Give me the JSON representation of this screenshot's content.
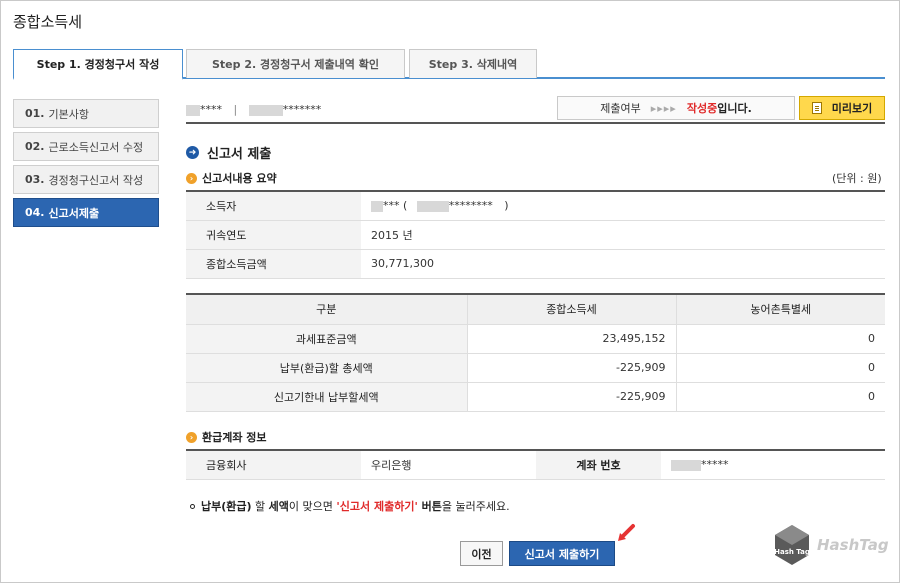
{
  "window": {
    "title": "종합소득세"
  },
  "tabs": [
    {
      "label": "Step 1. 경정청구서 작성",
      "active": true
    },
    {
      "label": "Step 2. 경정청구서 제출내역 확인",
      "active": false
    },
    {
      "label": "Step 3. 삭제내역",
      "active": false
    }
  ],
  "sidebar": [
    {
      "num": "01.",
      "label": "기본사항",
      "active": false
    },
    {
      "num": "02.",
      "label": "근로소득신고서 수정",
      "active": false
    },
    {
      "num": "03.",
      "label": "경정청구신고서 작성",
      "active": false
    },
    {
      "num": "04.",
      "label": "신고서제출",
      "active": true
    }
  ],
  "topbar": {
    "user_name_masked": "****",
    "separator": "|",
    "user_id_masked": "*******",
    "status_label": "제출여부",
    "status_arrows": "▸▸▸▸",
    "status_value": "작성중",
    "status_suffix": "입니다.",
    "preview_label": "미리보기"
  },
  "section": {
    "title": "신고서 제출"
  },
  "summary": {
    "title": "신고서내용 요약",
    "unit": "(단위 : 원)",
    "rows": [
      {
        "label": "소득자",
        "value_prefix": "***  (",
        "value_masked": "********",
        "value_suffix": ")"
      },
      {
        "label": "귀속연도",
        "value": "2015 년"
      },
      {
        "label": "종합소득금액",
        "value": "30,771,300"
      }
    ]
  },
  "tax_table": {
    "headers": [
      "구분",
      "종합소득세",
      "농어촌특별세"
    ],
    "rows": [
      {
        "label": "과세표준금액",
        "income_tax": "23,495,152",
        "rural_tax": "0"
      },
      {
        "label": "납부(환급)할 총세액",
        "income_tax": "-225,909",
        "rural_tax": "0"
      },
      {
        "label": "신고기한내 납부할세액",
        "income_tax": "-225,909",
        "rural_tax": "0"
      }
    ]
  },
  "refund": {
    "title": "환급계좌 정보",
    "bank_label": "금융회사",
    "bank_value": "우리은행",
    "account_label": "계좌 번호",
    "account_masked": "*****"
  },
  "notice": {
    "part1": "납부(환급)",
    "part2": " 할 ",
    "part3": "세액",
    "part4": "이 맞으면 ",
    "part5": "'신고서 제출하기'",
    "part6": " 버튼",
    "part7": "을 눌러주세요."
  },
  "buttons": {
    "prev": "이전",
    "submit": "신고서 제출하기"
  },
  "watermark": {
    "text": "HashTag",
    "badge": "Hash Tag"
  },
  "colors": {
    "accent": "#2c66b1",
    "status_red": "#e02a2a",
    "preview_yellow": "#ffd84c"
  }
}
